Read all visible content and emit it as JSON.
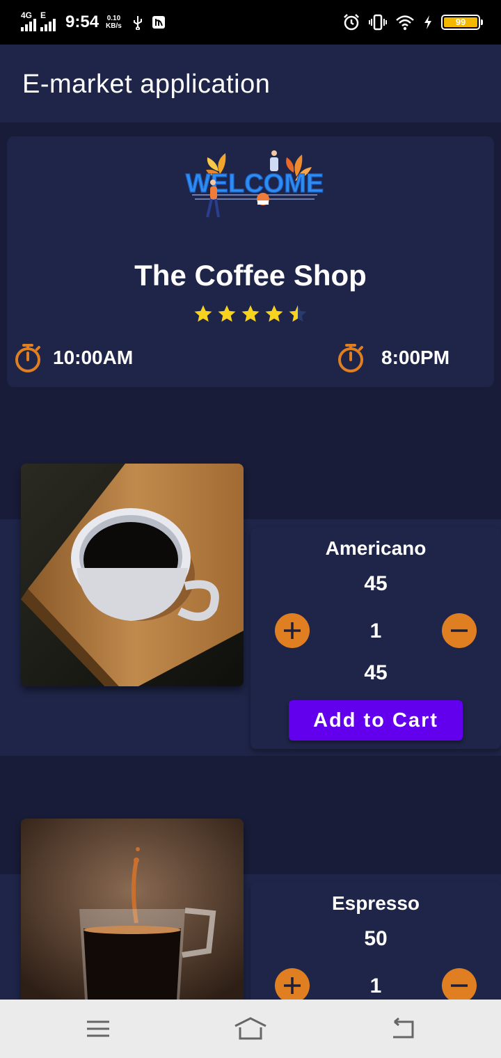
{
  "status_bar": {
    "network_1": "4G",
    "network_2": "E",
    "time": "9:54",
    "speed_value": "0.10",
    "speed_unit": "KB/s",
    "battery": "99",
    "icons": [
      "usb-icon",
      "debug-icon",
      "alarm-icon",
      "vibrate-icon",
      "wifi-icon",
      "charging-icon",
      "battery-icon"
    ]
  },
  "app_bar": {
    "title": "E-market application"
  },
  "shop": {
    "banner": "welcome-illustration",
    "banner_text": "WELCOME",
    "name": "The Coffee Shop",
    "rating": 4.5,
    "open_time": "10:00AM",
    "close_time": "8:00PM"
  },
  "products": [
    {
      "name": "Americano",
      "price": "45",
      "quantity": "1",
      "total": "45",
      "cart_label": "Add to Cart",
      "image": "americano-cup-photo"
    },
    {
      "name": "Espresso",
      "price": "50",
      "quantity": "1",
      "image": "espresso-glass-photo"
    }
  ],
  "colors": {
    "background": "#181c38",
    "card": "#1e2548",
    "accent_orange": "#e07f21",
    "button_purple": "#6200ee",
    "star": "#f7d21e"
  },
  "nav_bar": {
    "icons": [
      "menu-icon",
      "home-icon",
      "back-icon"
    ]
  }
}
